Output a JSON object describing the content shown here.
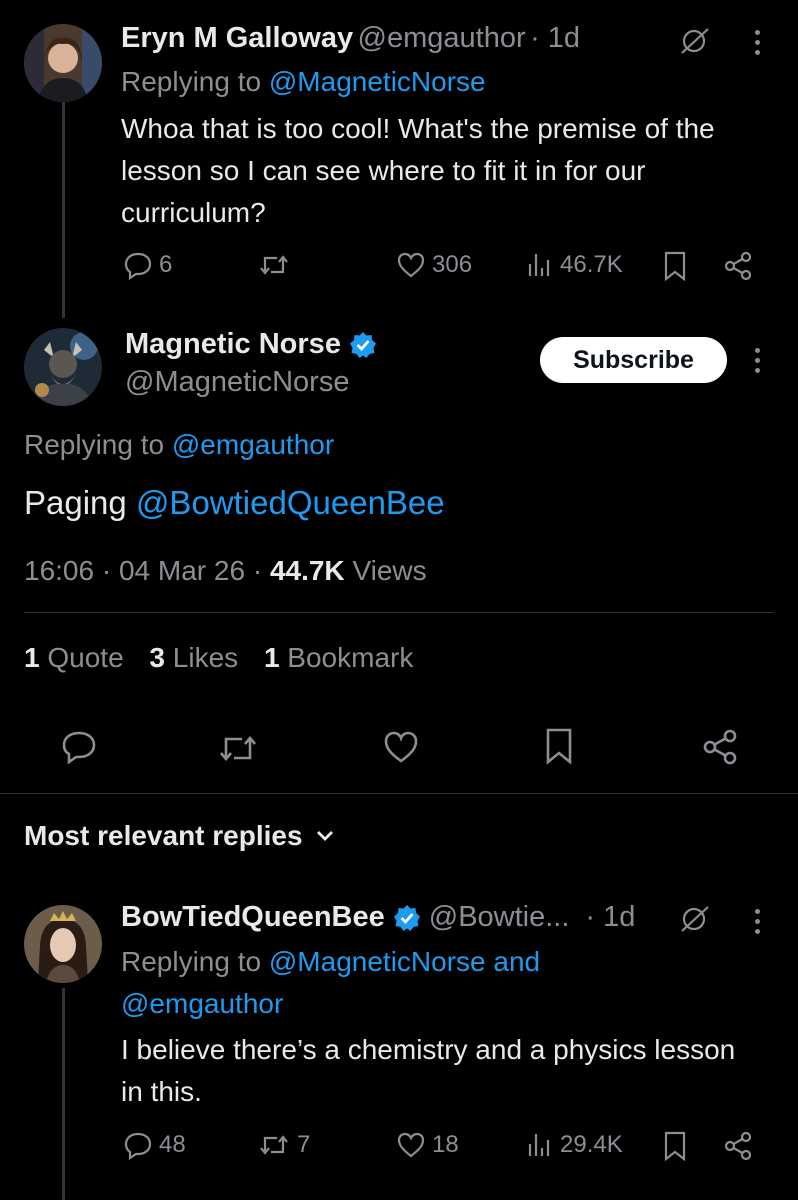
{
  "reply1": {
    "name": "Eryn M Galloway",
    "handle": "@emgauthor",
    "time": "· 1d",
    "replying_prefix": "Replying to",
    "replying_to": "@MagneticNorse",
    "text": "Whoa that is too cool! What's the premise of the lesson so I can see where to fit it in for our curriculum?",
    "replies": "6",
    "likes": "306",
    "views": "46.7K"
  },
  "main": {
    "name": "Magnetic Norse",
    "handle": "@MagneticNorse",
    "subscribe_label": "Subscribe",
    "replying_prefix": "Replying to",
    "replying_to": "@emgauthor",
    "text_prefix": "Paging",
    "mention": "@BowtiedQueenBee",
    "time": "16:06",
    "date": "04 Mar 26",
    "views_count": "44.7K",
    "views_label": "Views",
    "quotes_count": "1",
    "quotes_label": "Quote",
    "likes_count": "3",
    "likes_label": "Likes",
    "bookmarks_count": "1",
    "bookmarks_label": "Bookmark"
  },
  "sort": {
    "label": "Most relevant replies"
  },
  "reply2": {
    "name": "BowTiedQueenBee",
    "handle": "@Bowtie...",
    "time": "· 1d",
    "replying_prefix": "Replying to",
    "replying_to_1": "@MagneticNorse",
    "replying_and": "and",
    "replying_to_2": "@emgauthor",
    "text": "I believe there’s a chemistry and a physics lesson in this.",
    "replies": "48",
    "reposts": "7",
    "likes": "18",
    "views": "29.4K"
  },
  "colors": {
    "background": "#000000",
    "link": "#1d9bf0",
    "verified": "#1d9bf0",
    "muted": "#8b8f94"
  }
}
